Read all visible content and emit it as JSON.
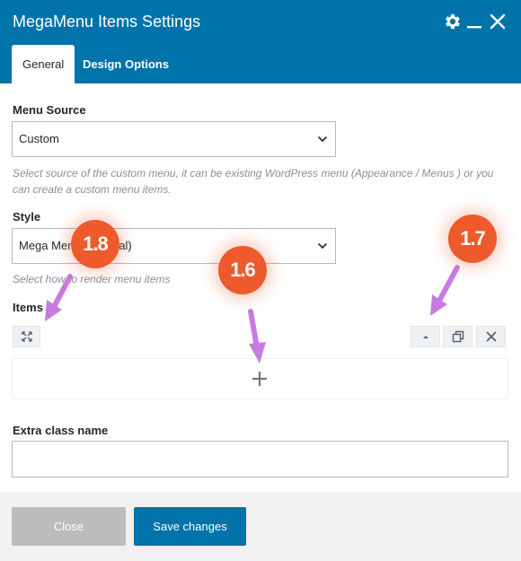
{
  "dialog": {
    "title": "MegaMenu Items Settings",
    "icons": {
      "settings": "gear-icon",
      "minimize": "minimize-icon",
      "close": "close-icon"
    }
  },
  "tabs": [
    {
      "label": "General",
      "active": true
    },
    {
      "label": "Design Options",
      "active": false
    }
  ],
  "fields": {
    "menu_source": {
      "label": "Menu Source",
      "value": "Custom",
      "help": [
        "Select source of the custom menu, it can be existing WordPress menu (Appearance / Menus ) or you",
        "can create a custom menu items."
      ]
    },
    "style": {
      "label": "Style",
      "value": "Mega Menu (Minimal)",
      "help": "Select how to render menu items"
    },
    "items": {
      "label": "Items",
      "controls": [
        "expand-icon",
        "move-up-icon",
        "clone-icon",
        "remove-icon"
      ],
      "add_icon": "plus-icon"
    },
    "extra_class": {
      "label": "Extra class name",
      "value": ""
    }
  },
  "footer": {
    "close_label": "Close",
    "save_label": "Save changes"
  },
  "annotations": [
    {
      "label": "1.8",
      "points_to": "expand-icon"
    },
    {
      "label": "1.6",
      "points_to": "plus-icon"
    },
    {
      "label": "1.7",
      "points_to": "move-up-icon"
    }
  ],
  "colors": {
    "header": "#0073aa",
    "primary_button": "#0073aa",
    "disabled_button": "#bcbcbc",
    "badge": "#ee5a2b",
    "arrow": "#c77be0"
  }
}
